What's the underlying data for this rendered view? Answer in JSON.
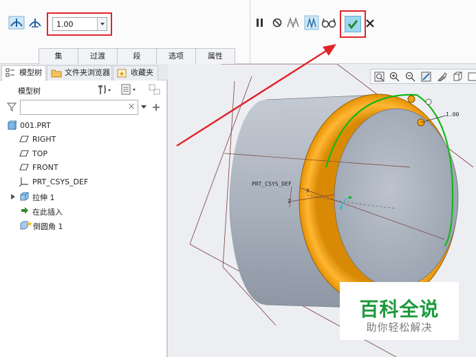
{
  "dashboard": {
    "value": "1.00",
    "tabs": [
      "集",
      "过渡",
      "段",
      "选项",
      "属性"
    ]
  },
  "navigator": {
    "tabs": [
      "模型树",
      "文件夹浏览器",
      "收藏夹"
    ],
    "tree_title": "模型树",
    "filter_placeholder": "",
    "items": [
      "001.PRT",
      "RIGHT",
      "TOP",
      "FRONT",
      "PRT_CSYS_DEF",
      "拉伸 1",
      "在此插入",
      "倒圆角 1"
    ]
  },
  "viewport": {
    "csys_label": "PRT_CSYS_DEF",
    "dimension_value": "1.00",
    "axis_z": "Z",
    "axis_x": "X"
  },
  "watermark": {
    "title": "百科全说",
    "subtitle": "助你轻松解决"
  },
  "colors": {
    "accent_red": "#e0242a",
    "round_orange": "#f5a20c",
    "cylinder_gray": "#a8b0bc",
    "ok_blue": "#9ed6ef",
    "watermark_green": "#1d9a3c"
  }
}
